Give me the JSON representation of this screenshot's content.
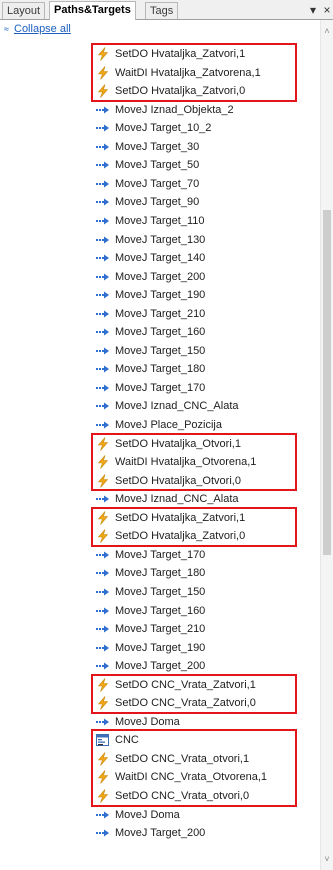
{
  "tabs": [
    {
      "label": "Layout",
      "active": false
    },
    {
      "label": "Paths&Targets",
      "active": true
    },
    {
      "label": "Tags",
      "active": false
    }
  ],
  "tab_controls": {
    "dropdown_icon": "dropdown-pin-icon",
    "close_icon": "close-icon",
    "dropdown_glyph": "▾",
    "close_glyph": "×"
  },
  "collapse_all": {
    "glyph": "≈",
    "label": "Collapse all"
  },
  "instructions": [
    {
      "type": "signal",
      "text": "SetDO Hvataljka_Zatvori,1"
    },
    {
      "type": "signal",
      "text": "WaitDI Hvataljka_Zatvorena,1"
    },
    {
      "type": "signal",
      "text": "SetDO Hvataljka_Zatvori,0"
    },
    {
      "type": "move",
      "text": "MoveJ Iznad_Objekta_2"
    },
    {
      "type": "move",
      "text": "MoveJ Target_10_2"
    },
    {
      "type": "move",
      "text": "MoveJ Target_30"
    },
    {
      "type": "move",
      "text": "MoveJ Target_50"
    },
    {
      "type": "move",
      "text": "MoveJ Target_70"
    },
    {
      "type": "move",
      "text": "MoveJ Target_90"
    },
    {
      "type": "move",
      "text": "MoveJ Target_110"
    },
    {
      "type": "move",
      "text": "MoveJ Target_130"
    },
    {
      "type": "move",
      "text": "MoveJ Target_140"
    },
    {
      "type": "move",
      "text": "MoveJ Target_200"
    },
    {
      "type": "move",
      "text": "MoveJ Target_190"
    },
    {
      "type": "move",
      "text": "MoveJ Target_210"
    },
    {
      "type": "move",
      "text": "MoveJ Target_160"
    },
    {
      "type": "move",
      "text": "MoveJ Target_150"
    },
    {
      "type": "move",
      "text": "MoveJ Target_180"
    },
    {
      "type": "move",
      "text": "MoveJ Target_170"
    },
    {
      "type": "move",
      "text": "MoveJ Iznad_CNC_Alata"
    },
    {
      "type": "move",
      "text": "MoveJ Place_Pozicija"
    },
    {
      "type": "signal",
      "text": "SetDO Hvataljka_Otvori,1"
    },
    {
      "type": "signal",
      "text": "WaitDI Hvataljka_Otvorena,1"
    },
    {
      "type": "signal",
      "text": "SetDO Hvataljka_Otvori,0"
    },
    {
      "type": "move",
      "text": "MoveJ Iznad_CNC_Alata"
    },
    {
      "type": "signal",
      "text": "SetDO Hvataljka_Zatvori,1"
    },
    {
      "type": "signal",
      "text": "SetDO Hvataljka_Zatvori,0"
    },
    {
      "type": "move",
      "text": "MoveJ Target_170"
    },
    {
      "type": "move",
      "text": "MoveJ Target_180"
    },
    {
      "type": "move",
      "text": "MoveJ Target_150"
    },
    {
      "type": "move",
      "text": "MoveJ Target_160"
    },
    {
      "type": "move",
      "text": "MoveJ Target_210"
    },
    {
      "type": "move",
      "text": "MoveJ Target_190"
    },
    {
      "type": "move",
      "text": "MoveJ Target_200"
    },
    {
      "type": "signal",
      "text": "SetDO CNC_Vrata_Zatvori,1"
    },
    {
      "type": "signal",
      "text": "SetDO CNC_Vrata_Zatvori,0"
    },
    {
      "type": "move",
      "text": "MoveJ Doma"
    },
    {
      "type": "proc",
      "text": "CNC"
    },
    {
      "type": "signal",
      "text": "SetDO CNC_Vrata_otvori,1"
    },
    {
      "type": "signal",
      "text": "WaitDI CNC_Vrata_Otvorena,1"
    },
    {
      "type": "signal",
      "text": "SetDO CNC_Vrata_otvori,0"
    },
    {
      "type": "move",
      "text": "MoveJ Doma"
    },
    {
      "type": "move",
      "text": "MoveJ Target_200"
    }
  ],
  "highlight_groups": [
    [
      0,
      2
    ],
    [
      21,
      23
    ],
    [
      25,
      26
    ],
    [
      34,
      35
    ],
    [
      37,
      40
    ]
  ],
  "icon_names": {
    "move": "move-joint-icon",
    "signal": "lightning-signal-icon",
    "proc": "procedure-call-icon"
  },
  "colors": {
    "highlight": "#e4141b",
    "move_icon": "#2f6fcf",
    "signal_icon": "#f0a818",
    "link": "#1c5fbd"
  },
  "scrollbar": {
    "up_glyph": "˄",
    "down_glyph": "˅"
  }
}
